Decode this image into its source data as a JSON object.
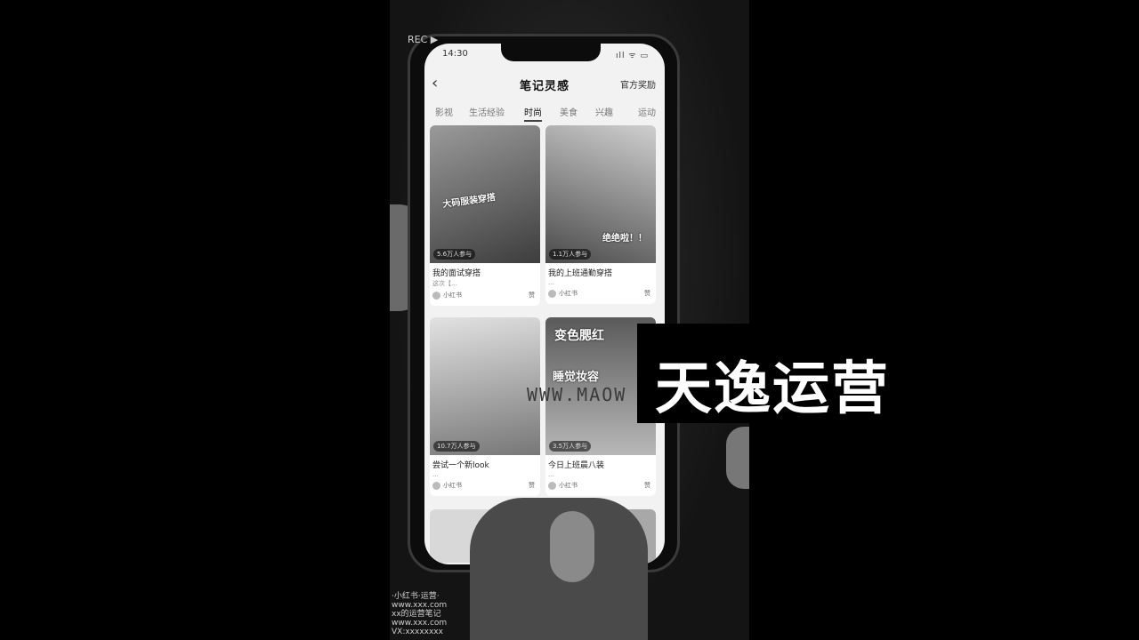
{
  "status_bar": {
    "time": "14:30",
    "icons": "ıll ᯤ ▭"
  },
  "app": {
    "title": "笔记灵感",
    "right_label": "官方奖励",
    "back_icon": "chevron-left-icon"
  },
  "tabs": [
    {
      "label": "影视",
      "active": false
    },
    {
      "label": "生活经验",
      "active": false
    },
    {
      "label": "时尚",
      "active": true
    },
    {
      "label": "美食",
      "active": false
    },
    {
      "label": "兴趣",
      "active": false
    },
    {
      "label": "运动",
      "active": false
    }
  ],
  "cards": [
    {
      "title": "我的面试穿搭",
      "sub": "这次【…",
      "badge": "5.6万人参与",
      "img_text": "大码服装穿搭",
      "author": "小红书",
      "likes": "赞"
    },
    {
      "title": "我的上班通勤穿搭",
      "sub": "…",
      "badge": "1.1万人参与",
      "img_text": "绝绝啦！！",
      "author": "小红书",
      "likes": "赞"
    },
    {
      "title": "尝试一个新look",
      "sub": "…",
      "badge": "10.7万人参与",
      "img_text": "",
      "author": "小红书",
      "likes": "赞"
    },
    {
      "title": "今日上班晨八装",
      "sub": "…",
      "badge": "3.5万人参与",
      "img_text": "变色腮红",
      "img_text2": "睡觉妆容",
      "author": "小红书",
      "likes": "赞"
    }
  ],
  "overlay": {
    "watermark_url": "WWW.MAOW",
    "brand": "天逸运营",
    "recorder_tag": "REC ▶"
  },
  "credits": [
    "·小红书·运营·",
    "www.xxx.com",
    "xx的运营笔记",
    "www.xxx.com",
    "VX:xxxxxxxx"
  ]
}
